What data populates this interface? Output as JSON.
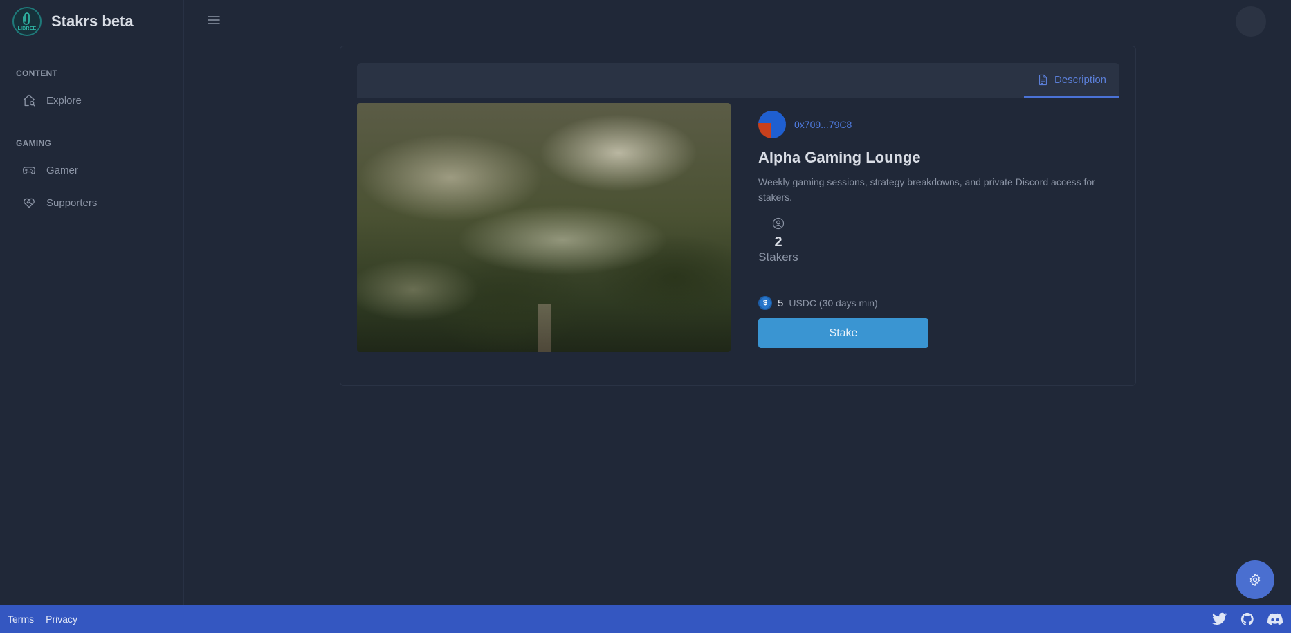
{
  "app": {
    "title": "Stakrs beta",
    "logo_text": "LIBREE"
  },
  "sidebar": {
    "sections": [
      {
        "label": "CONTENT",
        "items": [
          {
            "label": "Explore",
            "icon": "home-search-icon"
          }
        ]
      },
      {
        "label": "GAMING",
        "items": [
          {
            "label": "Gamer",
            "icon": "gamepad-icon"
          },
          {
            "label": "Supporters",
            "icon": "heart-handshake-icon"
          }
        ]
      }
    ]
  },
  "card": {
    "tab_label": "Description",
    "owner_address": "0x709...79C8",
    "title": "Alpha Gaming Lounge",
    "description": "Weekly gaming sessions, strategy breakdowns, and private Discord access for stakers.",
    "stakers_count": "2",
    "stakers_label": "Stakers",
    "price_value": "5",
    "price_unit": "USDC (30 days min)",
    "stake_button": "Stake"
  },
  "footer": {
    "terms": "Terms",
    "privacy": "Privacy",
    "icons": [
      "twitter-icon",
      "github-icon",
      "discord-icon"
    ]
  },
  "colors": {
    "background": "#202838",
    "accent": "#4a72d6",
    "footer": "#3457c1",
    "stake_button": "#3a95d2"
  }
}
